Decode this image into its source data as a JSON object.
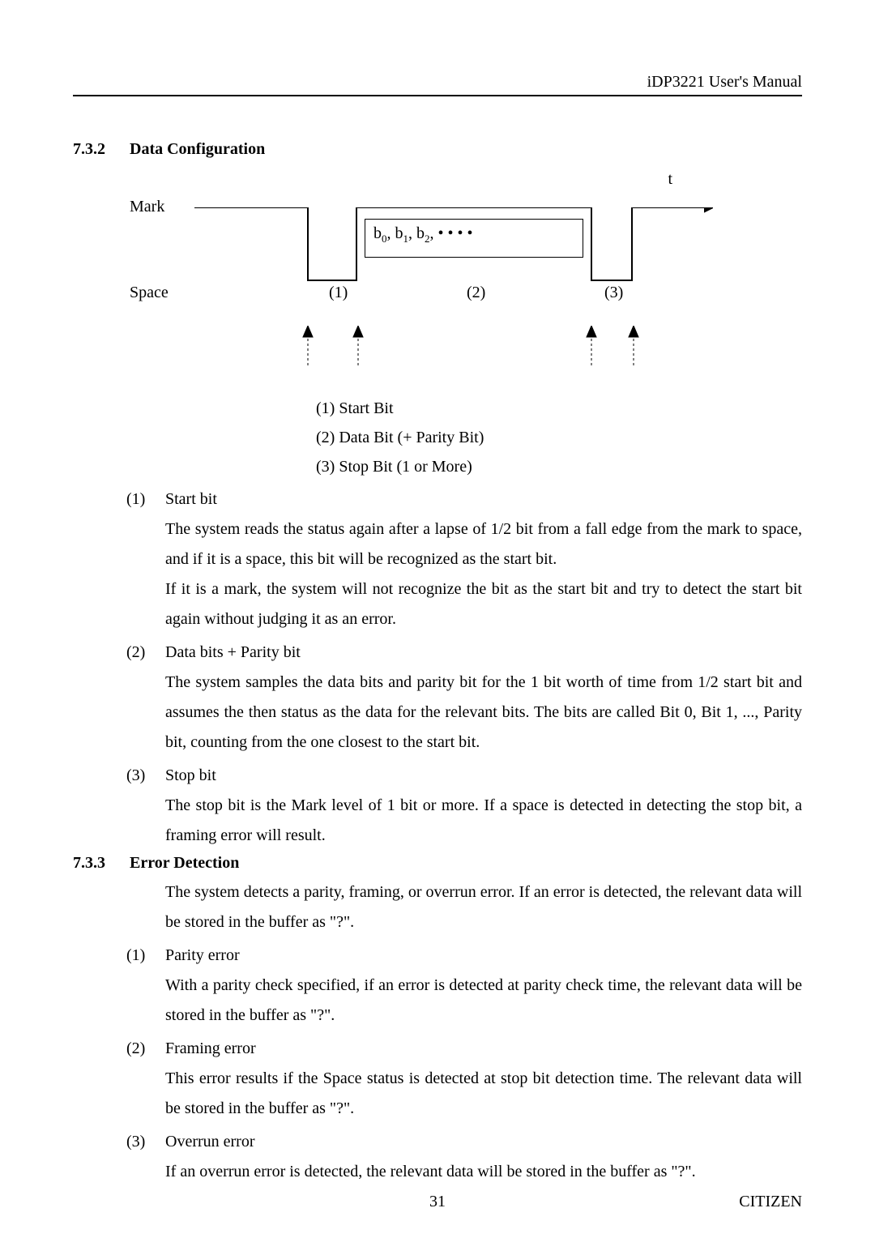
{
  "header": {
    "title": "iDP3221 User's Manual"
  },
  "section732": {
    "num": "7.3.2",
    "title": "Data Configuration",
    "diagram": {
      "mark": "Mark",
      "space": "Space",
      "t": "t",
      "databits_prefix_b": "b",
      "databits_text": ", b",
      "databits_tail": ", • • • •",
      "zone1": "(1)",
      "zone2": "(2)",
      "zone3": "(3)"
    },
    "legend": {
      "l1": "(1) Start Bit",
      "l2": "(2) Data Bit (+ Parity Bit)",
      "l3": "(3) Stop Bit (1 or More)"
    },
    "items": [
      {
        "num": "(1)",
        "label": "Start bit",
        "paras": [
          "The system reads the status again after a lapse of 1/2 bit from a fall edge from the mark to space, and if it is a space, this bit will be recognized as the start bit.",
          "If it is a mark, the system will not recognize the bit as the start bit and try to detect the start bit again without judging it as an error."
        ]
      },
      {
        "num": "(2)",
        "label": "Data bits + Parity bit",
        "paras": [
          "The system samples the data bits and parity bit for the 1 bit worth of time from 1/2 start bit and assumes the then status as the data for the relevant bits.    The bits are called Bit 0, Bit 1, ..., Parity bit, counting from the one closest to the start bit."
        ]
      },
      {
        "num": "(3)",
        "label": "Stop bit",
        "paras": [
          "The stop bit is the Mark level of 1 bit or more.   If a space is detected in detecting the stop bit, a framing error will result."
        ]
      }
    ]
  },
  "section733": {
    "num": "7.3.3",
    "title": "Error Detection",
    "intro": "The system detects a parity, framing, or overrun error.    If an error is detected, the relevant data will be stored in the buffer as \"?\".",
    "items": [
      {
        "num": "(1)",
        "label": "Parity error",
        "paras": [
          "With a parity check specified, if an error is detected at parity check time, the relevant data will be stored in the buffer as \"?\"."
        ]
      },
      {
        "num": "(2)",
        "label": "Framing error",
        "paras": [
          "This error results if the Space status is detected at stop bit detection time.  The relevant data will be stored in the buffer as \"?\"."
        ]
      },
      {
        "num": "(3)",
        "label": "Overrun error",
        "paras": [
          "If an overrun error is detected, the relevant data will be stored in the buffer as \"?\"."
        ]
      }
    ]
  },
  "footer": {
    "page": "31",
    "brand": "CITIZEN"
  }
}
